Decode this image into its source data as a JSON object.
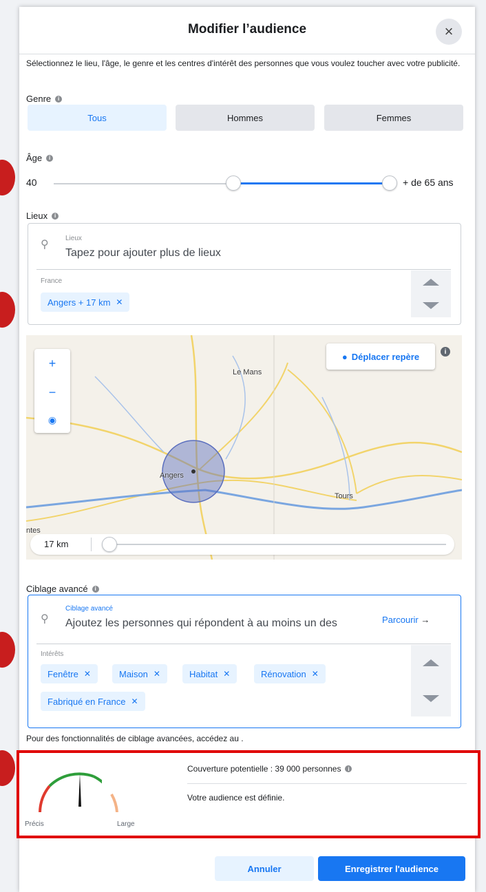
{
  "dialog": {
    "title": "Modifier l’audience",
    "close_label": "×"
  },
  "description": "Sélectionnez le lieu, l'âge, le genre et les centres d'intérêt des personnes que vous voulez toucher avec votre publicité.",
  "gender": {
    "label": "Genre",
    "options": [
      "Tous",
      "Hommes",
      "Femmes"
    ],
    "selected": "Tous"
  },
  "age": {
    "label": "Âge",
    "min_value": "40",
    "max_value": "+ de 65 ans"
  },
  "locations": {
    "label": "Lieux",
    "field_label": "Lieux",
    "placeholder": "Tapez pour ajouter plus de lieux",
    "country": "France",
    "chips": [
      "Angers  + 17 km"
    ]
  },
  "map": {
    "move_button": "Déplacer repère",
    "cities": [
      "Le Mans",
      "Angers",
      "Tours",
      "ntes"
    ],
    "radius_value": "17 km",
    "zoom_in": "+",
    "zoom_out": "−"
  },
  "advanced": {
    "label": "Ciblage avancé",
    "field_label": "Ciblage avancé",
    "placeholder": "Ajoutez les personnes qui répondent à au moins un des",
    "browse_label": "Parcourir",
    "interests_label": "Intérêts",
    "interests": [
      "Fenêtre",
      "Maison",
      "Habitat",
      "Rénovation",
      "Fabriqué en France"
    ],
    "note": "Pour des fonctionnalités de ciblage avancées, accédez au ."
  },
  "reach": {
    "left_label": "Précis",
    "right_label": "Large",
    "coverage": "Couverture potentielle : 39 000 personnes",
    "status": "Votre audience est définie."
  },
  "footer": {
    "cancel_label": "Annuler",
    "save_label": "Enregistrer l'audience"
  },
  "colors": {
    "accent": "#1877f2",
    "highlight": "#e00000",
    "gauge_green": "#2e9e3a",
    "gauge_red": "#e03a2e"
  }
}
